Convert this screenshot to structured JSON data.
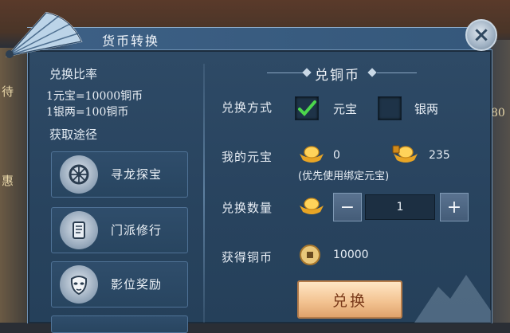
{
  "window": {
    "title": "货币转换",
    "close_label": "×"
  },
  "left": {
    "rate_header": "兑换比率",
    "rates": [
      "1元宝=10000铜币",
      "1银两=100铜币"
    ],
    "route_header": "获取途径",
    "routes": [
      {
        "label": "寻龙探宝",
        "icon": "cart-wheel-icon"
      },
      {
        "label": "门派修行",
        "icon": "scroll-icon"
      },
      {
        "label": "影位奖励",
        "icon": "mask-icon"
      }
    ]
  },
  "right": {
    "section_title": "兑铜币",
    "method_label": "兑换方式",
    "option_yuanbao": "元宝",
    "option_yinliang": "银两",
    "yuanbao_checked": true,
    "my_yuanbao_label": "我的元宝",
    "my_yuanbao_value": "0",
    "bound_yuanbao_value": "235",
    "bound_note": "(优先使用绑定元宝)",
    "qty_label": "兑换数量",
    "minus": "−",
    "plus": "+",
    "qty_value": "1",
    "gain_label": "获得铜币",
    "gain_value": "10000",
    "exchange_button": "兑换"
  },
  "background": {
    "side_texts": [
      "待",
      "惠",
      "80"
    ]
  },
  "colors": {
    "panel": "#2e4a66",
    "border": "#6d8fb1",
    "button": "#f3c493",
    "check": "#4cd64c"
  }
}
